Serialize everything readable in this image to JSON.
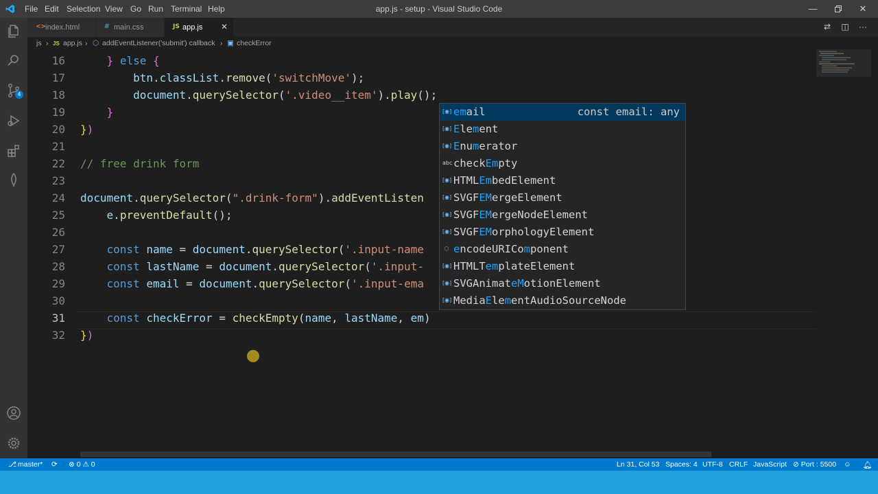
{
  "app": {
    "title": "app.js - setup - Visual Studio Code"
  },
  "menu": [
    "File",
    "Edit",
    "Selection",
    "View",
    "Go",
    "Run",
    "Terminal",
    "Help"
  ],
  "activity_bar": {
    "source_control_badge": "4"
  },
  "tabs": [
    {
      "label": "index.html",
      "icon": "<>",
      "color": "#e37933"
    },
    {
      "label": "main.css",
      "icon": "#",
      "color": "#519aba"
    },
    {
      "label": "app.js",
      "icon": "JS",
      "color": "#cbcb41",
      "active": true,
      "close": "✕"
    }
  ],
  "breadcrumb": {
    "folder": "js",
    "sep1": "›",
    "file_icon": "JS",
    "file": "app.js",
    "sep2": "›",
    "callback": "addEventListener('submit') callback",
    "sep3": "›",
    "symbol": "checkError"
  },
  "editor": {
    "line_numbers": [
      "16",
      "17",
      "18",
      "19",
      "20",
      "21",
      "22",
      "23",
      "24",
      "25",
      "26",
      "27",
      "28",
      "29",
      "30",
      "31",
      "32"
    ],
    "current_line": "31"
  },
  "suggestions": [
    {
      "label_pre": "",
      "label_hi": "em",
      "label_post": "ail",
      "detail": "const email: any",
      "kind": "var"
    },
    {
      "label_pre": "",
      "label_hi": "E",
      "label_post": "le",
      "label_hi2": "m",
      "label_post2": "ent",
      "kind": "var"
    },
    {
      "label_pre": "",
      "label_hi": "E",
      "label_post": "nu",
      "label_hi2": "m",
      "label_post2": "erator",
      "kind": "var"
    },
    {
      "label_pre": "check",
      "label_hi": "Em",
      "label_post": "pty",
      "kind": "abc"
    },
    {
      "label_pre": "HTML",
      "label_hi": "Em",
      "label_post": "bedElement",
      "kind": "var"
    },
    {
      "label_pre": "SVGF",
      "label_hi": "EM",
      "label_post": "ergeElement",
      "kind": "var"
    },
    {
      "label_pre": "SVGF",
      "label_hi": "EM",
      "label_post": "ergeNodeElement",
      "kind": "var"
    },
    {
      "label_pre": "SVGF",
      "label_hi": "EM",
      "label_post": "orphologyElement",
      "kind": "var"
    },
    {
      "label_pre": "",
      "label_hi": "e",
      "label_post": "ncodeURICo",
      "label_hi2": "m",
      "label_post2": "ponent",
      "kind": "fn"
    },
    {
      "label_pre": "HTMLT",
      "label_hi": "em",
      "label_post": "plateElement",
      "kind": "var"
    },
    {
      "label_pre": "SVGAnimat",
      "label_hi": "eM",
      "label_post": "otionElement",
      "kind": "var"
    },
    {
      "label_pre": "Media",
      "label_hi": "E",
      "label_post": "le",
      "label_hi2": "m",
      "label_post2": "entAudioSourceNode",
      "kind": "var"
    }
  ],
  "status": {
    "branch": "master*",
    "sync": "⟳",
    "problems": "⊗ 0 ⚠ 0",
    "position": "Ln 31, Col 53",
    "spaces": "Spaces: 4",
    "encoding": "UTF-8",
    "eol": "CRLF",
    "language": "JavaScript",
    "port": "⊘ Port : 5500"
  },
  "colors": {
    "accent": "#007acc",
    "editor_bg": "#1e1e1e",
    "suggest_selected": "#04395e",
    "match": "#18a3ff"
  }
}
